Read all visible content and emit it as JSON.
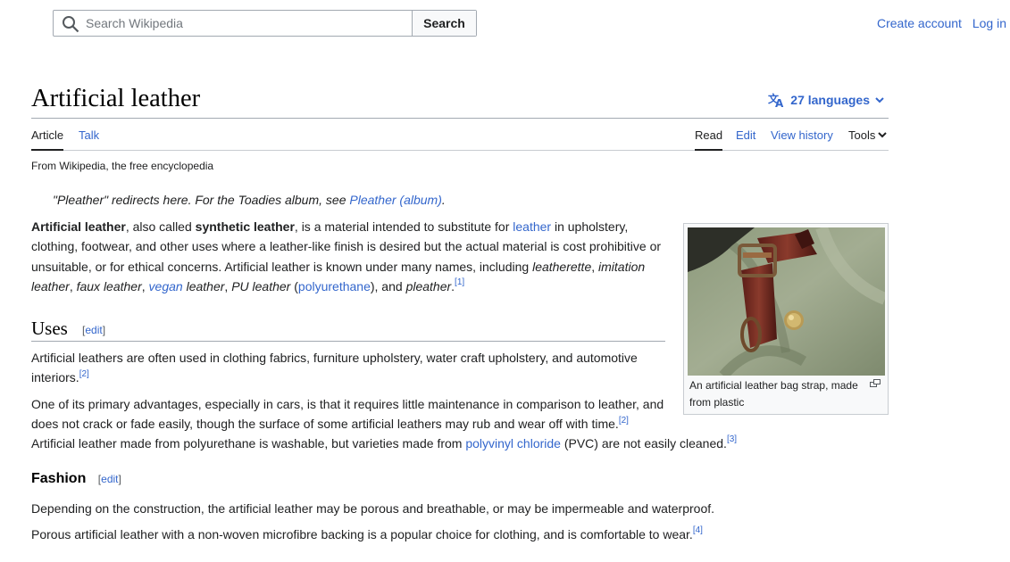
{
  "header": {
    "search_placeholder": "Search Wikipedia",
    "search_button": "Search",
    "create_account": "Create account",
    "log_in": "Log in"
  },
  "title": "Artificial leather",
  "languages": "27 languages",
  "tabs": {
    "article": "Article",
    "talk": "Talk",
    "read": "Read",
    "edit": "Edit",
    "history": "View history",
    "tools": "Tools"
  },
  "tagline": "From Wikipedia, the free encyclopedia",
  "hatnote": {
    "text": "\"Pleather\" redirects here. For the Toadies album, see ",
    "link": "Pleather (album)",
    "end": "."
  },
  "intro": {
    "b1": "Artificial leather",
    "t1": ", also called ",
    "b2": "synthetic leather",
    "t2": ", is a material intended to substitute for ",
    "l1": "leather",
    "t3": " in upholstery, clothing, footwear, and other uses where a leather-like finish is desired but the actual material is cost prohibitive or unsuitable, or for ethical concerns. Artificial leather is known under many names, including ",
    "i1": "leatherette",
    "t4": ", ",
    "i2": "imitation leather",
    "t5": ", ",
    "i3": "faux leather",
    "t6": ", ",
    "l2": "vegan",
    "i4": " leather",
    "t7": ", ",
    "i5": "PU leather",
    "t8": " (",
    "l3": "polyurethane",
    "t9": "), and ",
    "i6": "pleather",
    "t10": ".",
    "ref": "[1]"
  },
  "uses": {
    "heading": "Uses",
    "edit": "edit",
    "p1": "Artificial leathers are often used in clothing fabrics, furniture upholstery, water craft upholstery, and automotive interiors.",
    "p1_ref": "[2]",
    "p2": "One of its primary advantages, especially in cars, is that it requires little maintenance in comparison to leather, and does not crack or fade easily, though the surface of some artificial leathers may rub and wear off with time.",
    "p2_ref": "[2]",
    "p3a": "Artificial leather made from polyurethane is washable, but varieties made from ",
    "p3_link": "polyvinyl chloride",
    "p3b": " (PVC) are not easily cleaned.",
    "p3_ref": "[3]"
  },
  "fashion": {
    "heading": "Fashion",
    "edit": "edit",
    "p1": "Depending on the construction, the artificial leather may be porous and breathable, or may be impermeable and waterproof.",
    "p2": "Porous artificial leather with a non-woven microfibre backing is a popular choice for clothing, and is comfortable to wear.",
    "p2_ref": "[4]"
  },
  "figure": {
    "caption": "An artificial leather bag strap, made from plastic"
  },
  "colors": {
    "link": "#3366cc",
    "text": "#202122",
    "border": "#a2a9b1"
  }
}
